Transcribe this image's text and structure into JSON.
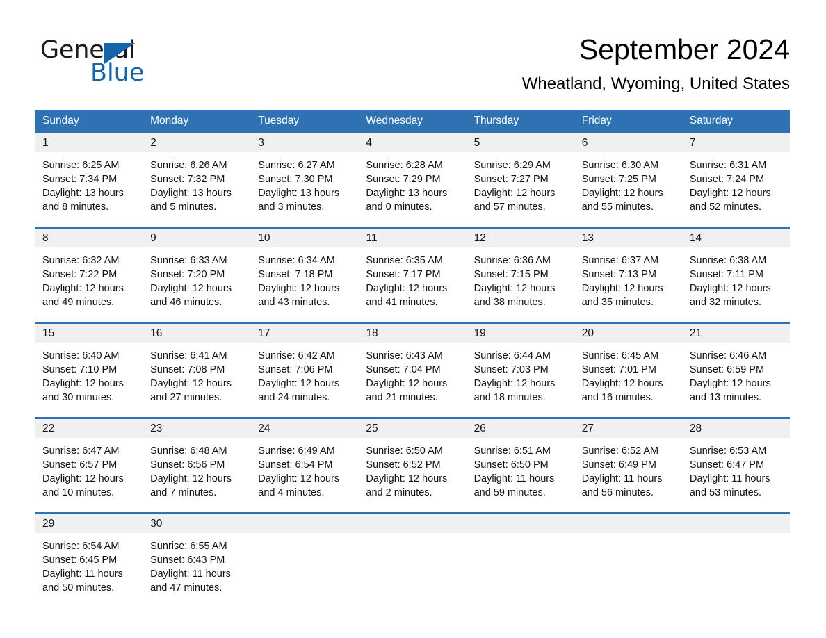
{
  "brand": {
    "name_part1": "General",
    "name_part2": "Blue",
    "triangle_icon": "triangle-icon",
    "primary_color": "#1565ad"
  },
  "header": {
    "title": "September 2024",
    "subtitle": "Wheatland, Wyoming, United States"
  },
  "calendar": {
    "header_bg": "#2f72b4",
    "date_band_bg": "#f0f0f0",
    "weekdays": [
      "Sunday",
      "Monday",
      "Tuesday",
      "Wednesday",
      "Thursday",
      "Friday",
      "Saturday"
    ],
    "weeks": [
      {
        "days": [
          {
            "date": "1",
            "sunrise": "Sunrise: 6:25 AM",
            "sunset": "Sunset: 7:34 PM",
            "daylight_line1": "Daylight: 13 hours",
            "daylight_line2": "and 8 minutes."
          },
          {
            "date": "2",
            "sunrise": "Sunrise: 6:26 AM",
            "sunset": "Sunset: 7:32 PM",
            "daylight_line1": "Daylight: 13 hours",
            "daylight_line2": "and 5 minutes."
          },
          {
            "date": "3",
            "sunrise": "Sunrise: 6:27 AM",
            "sunset": "Sunset: 7:30 PM",
            "daylight_line1": "Daylight: 13 hours",
            "daylight_line2": "and 3 minutes."
          },
          {
            "date": "4",
            "sunrise": "Sunrise: 6:28 AM",
            "sunset": "Sunset: 7:29 PM",
            "daylight_line1": "Daylight: 13 hours",
            "daylight_line2": "and 0 minutes."
          },
          {
            "date": "5",
            "sunrise": "Sunrise: 6:29 AM",
            "sunset": "Sunset: 7:27 PM",
            "daylight_line1": "Daylight: 12 hours",
            "daylight_line2": "and 57 minutes."
          },
          {
            "date": "6",
            "sunrise": "Sunrise: 6:30 AM",
            "sunset": "Sunset: 7:25 PM",
            "daylight_line1": "Daylight: 12 hours",
            "daylight_line2": "and 55 minutes."
          },
          {
            "date": "7",
            "sunrise": "Sunrise: 6:31 AM",
            "sunset": "Sunset: 7:24 PM",
            "daylight_line1": "Daylight: 12 hours",
            "daylight_line2": "and 52 minutes."
          }
        ]
      },
      {
        "days": [
          {
            "date": "8",
            "sunrise": "Sunrise: 6:32 AM",
            "sunset": "Sunset: 7:22 PM",
            "daylight_line1": "Daylight: 12 hours",
            "daylight_line2": "and 49 minutes."
          },
          {
            "date": "9",
            "sunrise": "Sunrise: 6:33 AM",
            "sunset": "Sunset: 7:20 PM",
            "daylight_line1": "Daylight: 12 hours",
            "daylight_line2": "and 46 minutes."
          },
          {
            "date": "10",
            "sunrise": "Sunrise: 6:34 AM",
            "sunset": "Sunset: 7:18 PM",
            "daylight_line1": "Daylight: 12 hours",
            "daylight_line2": "and 43 minutes."
          },
          {
            "date": "11",
            "sunrise": "Sunrise: 6:35 AM",
            "sunset": "Sunset: 7:17 PM",
            "daylight_line1": "Daylight: 12 hours",
            "daylight_line2": "and 41 minutes."
          },
          {
            "date": "12",
            "sunrise": "Sunrise: 6:36 AM",
            "sunset": "Sunset: 7:15 PM",
            "daylight_line1": "Daylight: 12 hours",
            "daylight_line2": "and 38 minutes."
          },
          {
            "date": "13",
            "sunrise": "Sunrise: 6:37 AM",
            "sunset": "Sunset: 7:13 PM",
            "daylight_line1": "Daylight: 12 hours",
            "daylight_line2": "and 35 minutes."
          },
          {
            "date": "14",
            "sunrise": "Sunrise: 6:38 AM",
            "sunset": "Sunset: 7:11 PM",
            "daylight_line1": "Daylight: 12 hours",
            "daylight_line2": "and 32 minutes."
          }
        ]
      },
      {
        "days": [
          {
            "date": "15",
            "sunrise": "Sunrise: 6:40 AM",
            "sunset": "Sunset: 7:10 PM",
            "daylight_line1": "Daylight: 12 hours",
            "daylight_line2": "and 30 minutes."
          },
          {
            "date": "16",
            "sunrise": "Sunrise: 6:41 AM",
            "sunset": "Sunset: 7:08 PM",
            "daylight_line1": "Daylight: 12 hours",
            "daylight_line2": "and 27 minutes."
          },
          {
            "date": "17",
            "sunrise": "Sunrise: 6:42 AM",
            "sunset": "Sunset: 7:06 PM",
            "daylight_line1": "Daylight: 12 hours",
            "daylight_line2": "and 24 minutes."
          },
          {
            "date": "18",
            "sunrise": "Sunrise: 6:43 AM",
            "sunset": "Sunset: 7:04 PM",
            "daylight_line1": "Daylight: 12 hours",
            "daylight_line2": "and 21 minutes."
          },
          {
            "date": "19",
            "sunrise": "Sunrise: 6:44 AM",
            "sunset": "Sunset: 7:03 PM",
            "daylight_line1": "Daylight: 12 hours",
            "daylight_line2": "and 18 minutes."
          },
          {
            "date": "20",
            "sunrise": "Sunrise: 6:45 AM",
            "sunset": "Sunset: 7:01 PM",
            "daylight_line1": "Daylight: 12 hours",
            "daylight_line2": "and 16 minutes."
          },
          {
            "date": "21",
            "sunrise": "Sunrise: 6:46 AM",
            "sunset": "Sunset: 6:59 PM",
            "daylight_line1": "Daylight: 12 hours",
            "daylight_line2": "and 13 minutes."
          }
        ]
      },
      {
        "days": [
          {
            "date": "22",
            "sunrise": "Sunrise: 6:47 AM",
            "sunset": "Sunset: 6:57 PM",
            "daylight_line1": "Daylight: 12 hours",
            "daylight_line2": "and 10 minutes."
          },
          {
            "date": "23",
            "sunrise": "Sunrise: 6:48 AM",
            "sunset": "Sunset: 6:56 PM",
            "daylight_line1": "Daylight: 12 hours",
            "daylight_line2": "and 7 minutes."
          },
          {
            "date": "24",
            "sunrise": "Sunrise: 6:49 AM",
            "sunset": "Sunset: 6:54 PM",
            "daylight_line1": "Daylight: 12 hours",
            "daylight_line2": "and 4 minutes."
          },
          {
            "date": "25",
            "sunrise": "Sunrise: 6:50 AM",
            "sunset": "Sunset: 6:52 PM",
            "daylight_line1": "Daylight: 12 hours",
            "daylight_line2": "and 2 minutes."
          },
          {
            "date": "26",
            "sunrise": "Sunrise: 6:51 AM",
            "sunset": "Sunset: 6:50 PM",
            "daylight_line1": "Daylight: 11 hours",
            "daylight_line2": "and 59 minutes."
          },
          {
            "date": "27",
            "sunrise": "Sunrise: 6:52 AM",
            "sunset": "Sunset: 6:49 PM",
            "daylight_line1": "Daylight: 11 hours",
            "daylight_line2": "and 56 minutes."
          },
          {
            "date": "28",
            "sunrise": "Sunrise: 6:53 AM",
            "sunset": "Sunset: 6:47 PM",
            "daylight_line1": "Daylight: 11 hours",
            "daylight_line2": "and 53 minutes."
          }
        ]
      },
      {
        "days": [
          {
            "date": "29",
            "sunrise": "Sunrise: 6:54 AM",
            "sunset": "Sunset: 6:45 PM",
            "daylight_line1": "Daylight: 11 hours",
            "daylight_line2": "and 50 minutes."
          },
          {
            "date": "30",
            "sunrise": "Sunrise: 6:55 AM",
            "sunset": "Sunset: 6:43 PM",
            "daylight_line1": "Daylight: 11 hours",
            "daylight_line2": "and 47 minutes."
          },
          {
            "date": "",
            "sunrise": "",
            "sunset": "",
            "daylight_line1": "",
            "daylight_line2": ""
          },
          {
            "date": "",
            "sunrise": "",
            "sunset": "",
            "daylight_line1": "",
            "daylight_line2": ""
          },
          {
            "date": "",
            "sunrise": "",
            "sunset": "",
            "daylight_line1": "",
            "daylight_line2": ""
          },
          {
            "date": "",
            "sunrise": "",
            "sunset": "",
            "daylight_line1": "",
            "daylight_line2": ""
          },
          {
            "date": "",
            "sunrise": "",
            "sunset": "",
            "daylight_line1": "",
            "daylight_line2": ""
          }
        ]
      }
    ]
  }
}
